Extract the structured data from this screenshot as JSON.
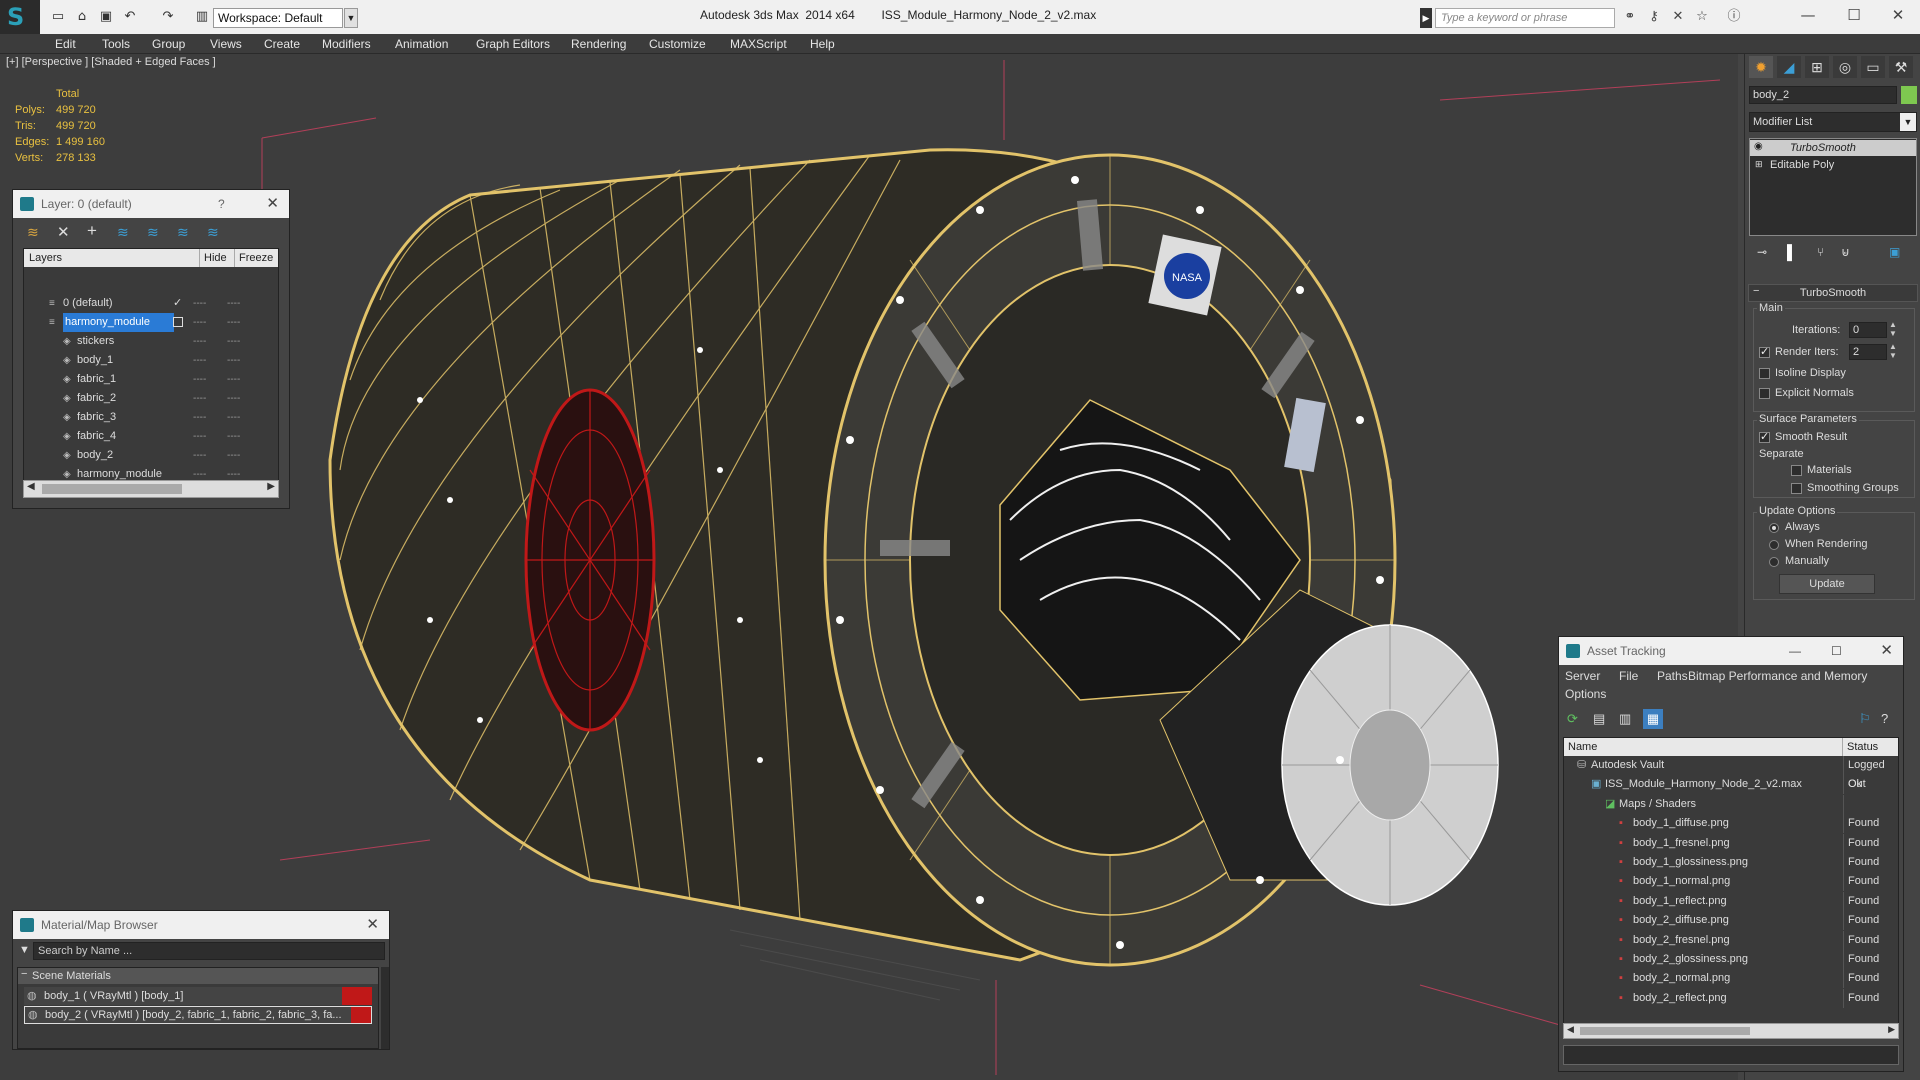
{
  "title_bar": {
    "app": "Autodesk 3ds Max  2014 x64",
    "file": "ISS_Module_Harmony_Node_2_v2.max",
    "workspace": "Workspace: Default",
    "search_placeholder": "Type a keyword or phrase"
  },
  "menu": [
    "Edit",
    "Tools",
    "Group",
    "Views",
    "Create",
    "Modifiers",
    "Animation",
    "Graph Editors",
    "Rendering",
    "Customize",
    "MAXScript",
    "Help"
  ],
  "viewport": {
    "label": "[+] [Perspective ] [Shaded + Edged Faces ]",
    "stats": {
      "header": "Total",
      "polys_label": "Polys:",
      "polys": "499 720",
      "tris_label": "Tris:",
      "tris": "499 720",
      "edges_label": "Edges:",
      "edges": "1 499 160",
      "verts_label": "Verts:",
      "verts": "278 133"
    }
  },
  "layer_panel": {
    "title": "Layer: 0 (default)",
    "help": "?",
    "columns": {
      "layers": "Layers",
      "hide": "Hide",
      "freeze": "Freeze"
    },
    "rows": [
      {
        "name": "0 (default)",
        "indent": 0,
        "selected": false
      },
      {
        "name": "harmony_module",
        "indent": 0,
        "selected": true
      },
      {
        "name": "stickers",
        "indent": 1,
        "selected": false
      },
      {
        "name": "body_1",
        "indent": 1,
        "selected": false
      },
      {
        "name": "fabric_1",
        "indent": 1,
        "selected": false
      },
      {
        "name": "fabric_2",
        "indent": 1,
        "selected": false
      },
      {
        "name": "fabric_3",
        "indent": 1,
        "selected": false
      },
      {
        "name": "fabric_4",
        "indent": 1,
        "selected": false
      },
      {
        "name": "body_2",
        "indent": 1,
        "selected": false
      },
      {
        "name": "harmony_module",
        "indent": 1,
        "selected": false
      }
    ],
    "dash": "----"
  },
  "command_panel": {
    "object_name": "body_2",
    "modifier_list": "Modifier List",
    "stack": [
      "TurboSmooth",
      "Editable Poly"
    ],
    "rollout": "TurboSmooth",
    "main": "Main",
    "iterations_label": "Iterations:",
    "iterations": "0",
    "render_iters_label": "Render Iters:",
    "render_iters": "2",
    "isoline": "Isoline Display",
    "explicit": "Explicit Normals",
    "surface_params": "Surface Parameters",
    "smooth_result": "Smooth Result",
    "separate": "Separate",
    "materials": "Materials",
    "smoothing_groups": "Smoothing Groups",
    "update_options": "Update Options",
    "always": "Always",
    "when_rendering": "When Rendering",
    "manually": "Manually",
    "update_btn": "Update",
    "accent": "#7ec850"
  },
  "asset_panel": {
    "title": "Asset Tracking",
    "menu": [
      "Server",
      "File",
      "Paths",
      "Bitmap Performance and Memory",
      "Options"
    ],
    "col_name": "Name",
    "col_status": "Status",
    "rows": [
      {
        "name": "Autodesk Vault",
        "status": "Logged Out",
        "indent": 0,
        "icon": "vault-icon"
      },
      {
        "name": "ISS_Module_Harmony_Node_2_v2.max",
        "status": "Ok",
        "indent": 1,
        "icon": "max-file-icon"
      },
      {
        "name": "Maps / Shaders",
        "status": "",
        "indent": 2,
        "icon": "maps-icon"
      },
      {
        "name": "body_1_diffuse.png",
        "status": "Found",
        "indent": 3,
        "icon": "png-icon"
      },
      {
        "name": "body_1_fresnel.png",
        "status": "Found",
        "indent": 3,
        "icon": "png-icon"
      },
      {
        "name": "body_1_glossiness.png",
        "status": "Found",
        "indent": 3,
        "icon": "png-icon"
      },
      {
        "name": "body_1_normal.png",
        "status": "Found",
        "indent": 3,
        "icon": "png-icon"
      },
      {
        "name": "body_1_reflect.png",
        "status": "Found",
        "indent": 3,
        "icon": "png-icon"
      },
      {
        "name": "body_2_diffuse.png",
        "status": "Found",
        "indent": 3,
        "icon": "png-icon"
      },
      {
        "name": "body_2_fresnel.png",
        "status": "Found",
        "indent": 3,
        "icon": "png-icon"
      },
      {
        "name": "body_2_glossiness.png",
        "status": "Found",
        "indent": 3,
        "icon": "png-icon"
      },
      {
        "name": "body_2_normal.png",
        "status": "Found",
        "indent": 3,
        "icon": "png-icon"
      },
      {
        "name": "body_2_reflect.png",
        "status": "Found",
        "indent": 3,
        "icon": "png-icon"
      }
    ]
  },
  "material_browser": {
    "title": "Material/Map Browser",
    "search_placeholder": "Search by Name ...",
    "group": "Scene Materials",
    "items": [
      "body_1  ( VRayMtl )  [body_1]",
      "body_2  ( VRayMtl )  [body_2, fabric_1, fabric_2, fabric_3, fa..."
    ]
  },
  "colors": {
    "wire": "#e2c36a",
    "hatch_wire": "#c01818",
    "selection": "#2a7bd6"
  }
}
